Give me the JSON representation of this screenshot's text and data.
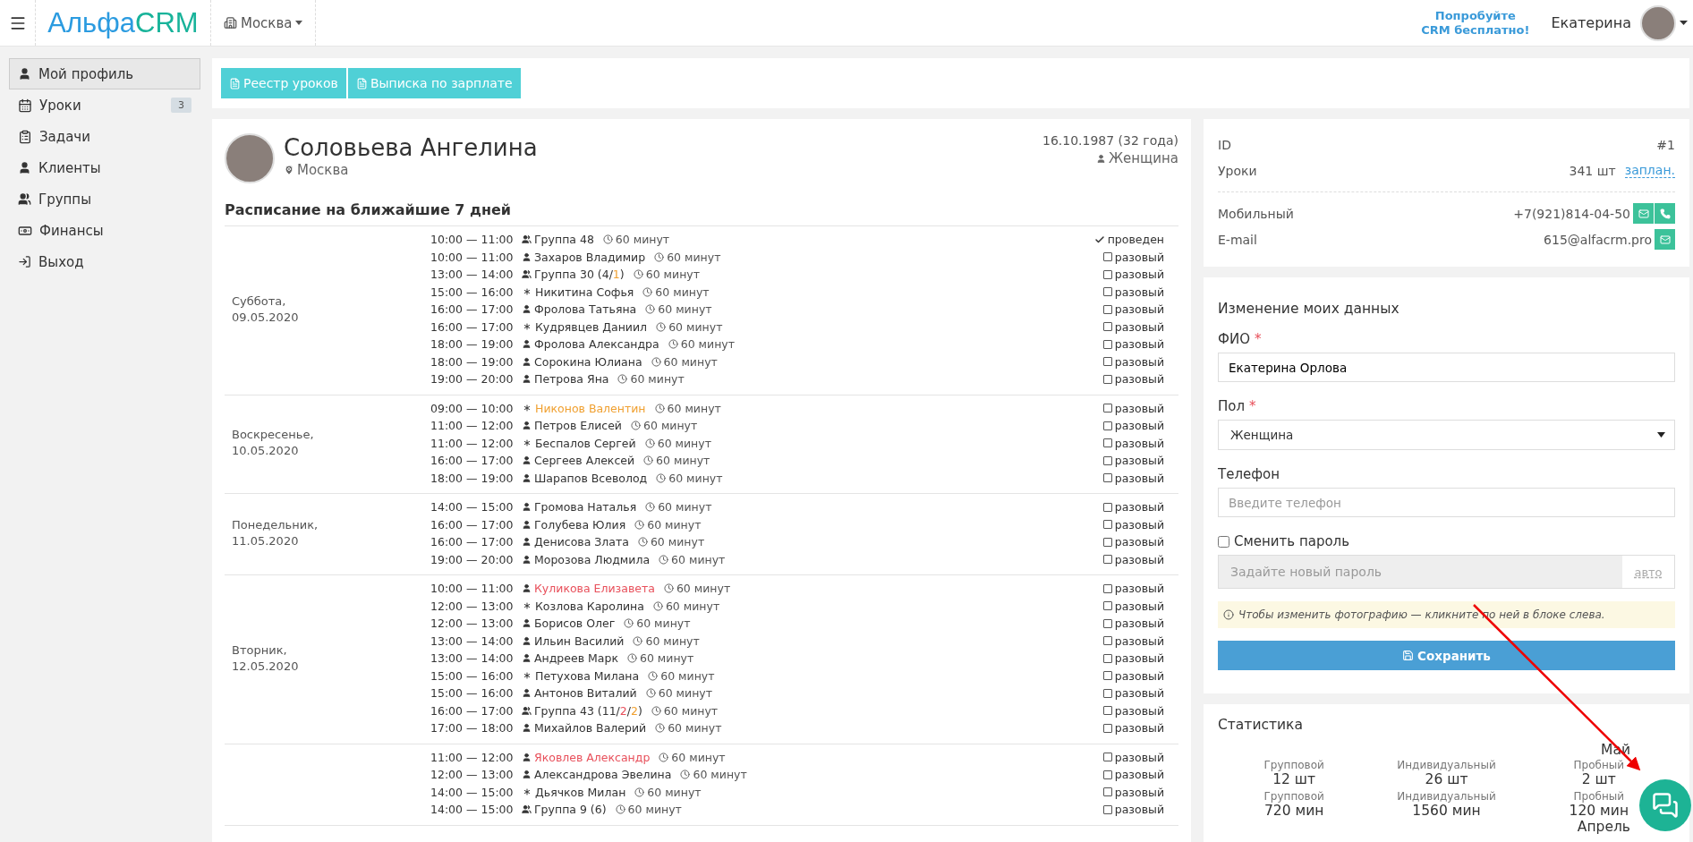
{
  "header": {
    "logo": [
      "Альфа",
      "CRM"
    ],
    "city": "Москва",
    "promo": [
      "Попробуйте",
      "CRM бесплатно!"
    ],
    "user": "Екатерина"
  },
  "sidebar": [
    {
      "kind": "profile",
      "label": "Мой профиль",
      "selected": true
    },
    {
      "kind": "lessons",
      "label": "Уроки",
      "badge": "3",
      "selected": false
    },
    {
      "kind": "tasks",
      "label": "Задачи",
      "selected": false
    },
    {
      "kind": "clients",
      "label": "Клиенты",
      "selected": false
    },
    {
      "kind": "groups",
      "label": "Группы",
      "selected": false
    },
    {
      "kind": "finance",
      "label": "Финансы",
      "selected": false
    },
    {
      "kind": "exit",
      "label": "Выход",
      "selected": false
    }
  ],
  "toolbar": [
    "Реестр уроков",
    "Выписка по зарплате"
  ],
  "profile": {
    "name": "Соловьева Ангелина",
    "city": "Москва",
    "birth": "16.10.1987 (32 года)",
    "gender": "Женщина"
  },
  "schedule": {
    "title": "Расписание на ближайшие 7 дней",
    "days": [
      {
        "label": [
          "Суббота,",
          "09.05.2020"
        ],
        "lessons": [
          {
            "time": "10:00 — 11:00",
            "kind": "group",
            "name_parts": [
              {
                "text": "Группа 48"
              }
            ],
            "duration": "60 минут",
            "status": "проведен",
            "done": true
          },
          {
            "time": "10:00 — 11:00",
            "kind": "person",
            "name_parts": [
              {
                "text": "Захаров Владимир"
              }
            ],
            "duration": "60 минут",
            "status": "разовый",
            "done": false
          },
          {
            "time": "13:00 — 14:00",
            "kind": "group",
            "name_parts": [
              {
                "text": "Группа 30 (4/"
              },
              {
                "text": "1",
                "color": "#f0a030"
              },
              {
                "text": ")"
              }
            ],
            "duration": "60 минут",
            "status": "разовый",
            "done": false
          },
          {
            "time": "15:00 — 16:00",
            "kind": "trial",
            "name_parts": [
              {
                "text": "Никитина Софья"
              }
            ],
            "duration": "60 минут",
            "status": "разовый",
            "done": false
          },
          {
            "time": "16:00 — 17:00",
            "kind": "person",
            "name_parts": [
              {
                "text": "Фролова Татьяна"
              }
            ],
            "duration": "60 минут",
            "status": "разовый",
            "done": false
          },
          {
            "time": "16:00 — 17:00",
            "kind": "trial",
            "name_parts": [
              {
                "text": "Кудрявцев Даниил"
              }
            ],
            "duration": "60 минут",
            "status": "разовый",
            "done": false
          },
          {
            "time": "18:00 — 19:00",
            "kind": "person",
            "name_parts": [
              {
                "text": "Фролова Александра"
              }
            ],
            "duration": "60 минут",
            "status": "разовый",
            "done": false
          },
          {
            "time": "18:00 — 19:00",
            "kind": "person",
            "name_parts": [
              {
                "text": "Сорокина Юлиана"
              }
            ],
            "duration": "60 минут",
            "status": "разовый",
            "done": false
          },
          {
            "time": "19:00 — 20:00",
            "kind": "person",
            "name_parts": [
              {
                "text": "Петрова Яна"
              }
            ],
            "duration": "60 минут",
            "status": "разовый",
            "done": false
          }
        ]
      },
      {
        "label": [
          "Воскресенье,",
          "10.05.2020"
        ],
        "lessons": [
          {
            "time": "09:00 — 10:00",
            "kind": "trial",
            "name_parts": [
              {
                "text": "Никонов Валентин",
                "color": "#f0a030"
              }
            ],
            "duration": "60 минут",
            "status": "разовый",
            "done": false
          },
          {
            "time": "11:00 — 12:00",
            "kind": "person",
            "name_parts": [
              {
                "text": "Петров Елисей"
              }
            ],
            "duration": "60 минут",
            "status": "разовый",
            "done": false
          },
          {
            "time": "11:00 — 12:00",
            "kind": "trial",
            "name_parts": [
              {
                "text": "Беспалов Сергей"
              }
            ],
            "duration": "60 минут",
            "status": "разовый",
            "done": false
          },
          {
            "time": "16:00 — 17:00",
            "kind": "person",
            "name_parts": [
              {
                "text": "Сергеев Алексей"
              }
            ],
            "duration": "60 минут",
            "status": "разовый",
            "done": false
          },
          {
            "time": "18:00 — 19:00",
            "kind": "person",
            "name_parts": [
              {
                "text": "Шарапов Всеволод"
              }
            ],
            "duration": "60 минут",
            "status": "разовый",
            "done": false
          }
        ]
      },
      {
        "label": [
          "Понедельник,",
          "11.05.2020"
        ],
        "lessons": [
          {
            "time": "14:00 — 15:00",
            "kind": "person",
            "name_parts": [
              {
                "text": "Громова Наталья"
              }
            ],
            "duration": "60 минут",
            "status": "разовый",
            "done": false
          },
          {
            "time": "16:00 — 17:00",
            "kind": "person",
            "name_parts": [
              {
                "text": "Голубева Юлия"
              }
            ],
            "duration": "60 минут",
            "status": "разовый",
            "done": false
          },
          {
            "time": "16:00 — 17:00",
            "kind": "person",
            "name_parts": [
              {
                "text": "Денисова Злата"
              }
            ],
            "duration": "60 минут",
            "status": "разовый",
            "done": false
          },
          {
            "time": "19:00 — 20:00",
            "kind": "person",
            "name_parts": [
              {
                "text": "Морозова Людмила"
              }
            ],
            "duration": "60 минут",
            "status": "разовый",
            "done": false
          }
        ]
      },
      {
        "label": [
          "Вторник,",
          "12.05.2020"
        ],
        "lessons": [
          {
            "time": "10:00 — 11:00",
            "kind": "person",
            "name_parts": [
              {
                "text": "Куликова Елизавета",
                "color": "#e8505b"
              }
            ],
            "duration": "60 минут",
            "status": "разовый",
            "done": false
          },
          {
            "time": "12:00 — 13:00",
            "kind": "trial",
            "name_parts": [
              {
                "text": "Козлова Каролина"
              }
            ],
            "duration": "60 минут",
            "status": "разовый",
            "done": false
          },
          {
            "time": "12:00 — 13:00",
            "kind": "person",
            "name_parts": [
              {
                "text": "Борисов Олег"
              }
            ],
            "duration": "60 минут",
            "status": "разовый",
            "done": false
          },
          {
            "time": "13:00 — 14:00",
            "kind": "person",
            "name_parts": [
              {
                "text": "Ильин Василий"
              }
            ],
            "duration": "60 минут",
            "status": "разовый",
            "done": false
          },
          {
            "time": "13:00 — 14:00",
            "kind": "person",
            "name_parts": [
              {
                "text": "Андреев Марк"
              }
            ],
            "duration": "60 минут",
            "status": "разовый",
            "done": false
          },
          {
            "time": "15:00 — 16:00",
            "kind": "trial",
            "name_parts": [
              {
                "text": "Петухова Милана"
              }
            ],
            "duration": "60 минут",
            "status": "разовый",
            "done": false
          },
          {
            "time": "15:00 — 16:00",
            "kind": "person",
            "name_parts": [
              {
                "text": "Антонов Виталий"
              }
            ],
            "duration": "60 минут",
            "status": "разовый",
            "done": false
          },
          {
            "time": "16:00 — 17:00",
            "kind": "group",
            "name_parts": [
              {
                "text": "Группа 43 (11/"
              },
              {
                "text": "2",
                "color": "#e8505b"
              },
              {
                "text": "/"
              },
              {
                "text": "2",
                "color": "#f0a030"
              },
              {
                "text": ")"
              }
            ],
            "duration": "60 минут",
            "status": "разовый",
            "done": false
          },
          {
            "time": "17:00 — 18:00",
            "kind": "person",
            "name_parts": [
              {
                "text": "Михайлов Валерий"
              }
            ],
            "duration": "60 минут",
            "status": "разовый",
            "done": false
          }
        ]
      },
      {
        "lessons": [
          {
            "time": "11:00 — 12:00",
            "kind": "person",
            "name_parts": [
              {
                "text": "Яковлев Александр",
                "color": "#e8505b"
              }
            ],
            "duration": "60 минут",
            "status": "разовый",
            "done": false
          },
          {
            "time": "12:00 — 13:00",
            "kind": "person",
            "name_parts": [
              {
                "text": "Александрова Эвелина"
              }
            ],
            "duration": "60 минут",
            "status": "разовый",
            "done": false
          },
          {
            "time": "14:00 — 15:00",
            "kind": "trial",
            "name_parts": [
              {
                "text": "Дьячков Милан"
              }
            ],
            "duration": "60 минут",
            "status": "разовый",
            "done": false
          },
          {
            "time": "14:00 — 15:00",
            "kind": "group",
            "name_parts": [
              {
                "text": "Группа 9 (6)"
              }
            ],
            "duration": "60 минут",
            "status": "разовый",
            "done": false
          }
        ]
      }
    ]
  },
  "info": {
    "rows": [
      {
        "label": "ID",
        "value": "#1"
      },
      {
        "label": "Уроки",
        "value": "341 шт",
        "link": "заплан."
      }
    ],
    "contacts": [
      {
        "label": "Мобильный",
        "value": "+7(921)814-04-50",
        "actions": [
          {
            "kind": "mail"
          },
          {
            "kind": "phone"
          }
        ]
      },
      {
        "label": "E-mail",
        "value": "615@alfacrm.pro",
        "actions": [
          {
            "kind": "mail"
          }
        ]
      }
    ]
  },
  "form": {
    "title": "Изменение моих данных",
    "fields": [
      {
        "kind": "text",
        "label": "ФИО",
        "required_mark": "*",
        "value": "Екатерина Орлова"
      },
      {
        "kind": "select",
        "label": "Пол",
        "required_mark": "*",
        "value": "Женщина"
      },
      {
        "kind": "text",
        "label": "Телефон",
        "placeholder": "Введите телефон"
      }
    ],
    "password": {
      "label": "Сменить пароль",
      "checked": false,
      "placeholder": "Задайте новый пароль",
      "auto": "авто"
    },
    "note": "Чтобы изменить фотографию — кликните по ней в блоке слева.",
    "save": "Сохранить"
  },
  "stats": {
    "title": "Статистика",
    "months": [
      {
        "name": "Май",
        "rows": [
          [
            {
              "label": "Групповой",
              "value": "12 шт"
            },
            {
              "label": "Индивидуальный",
              "value": "26 шт"
            },
            {
              "label": "Пробный",
              "value": "2 шт"
            }
          ],
          [
            {
              "label": "Групповой",
              "value": "720 мин"
            },
            {
              "label": "Индивидуальный",
              "value": "1560 мин"
            },
            {
              "label": "Пробный",
              "value": "120 мин"
            }
          ]
        ]
      },
      {
        "name": "Апрель"
      }
    ]
  }
}
